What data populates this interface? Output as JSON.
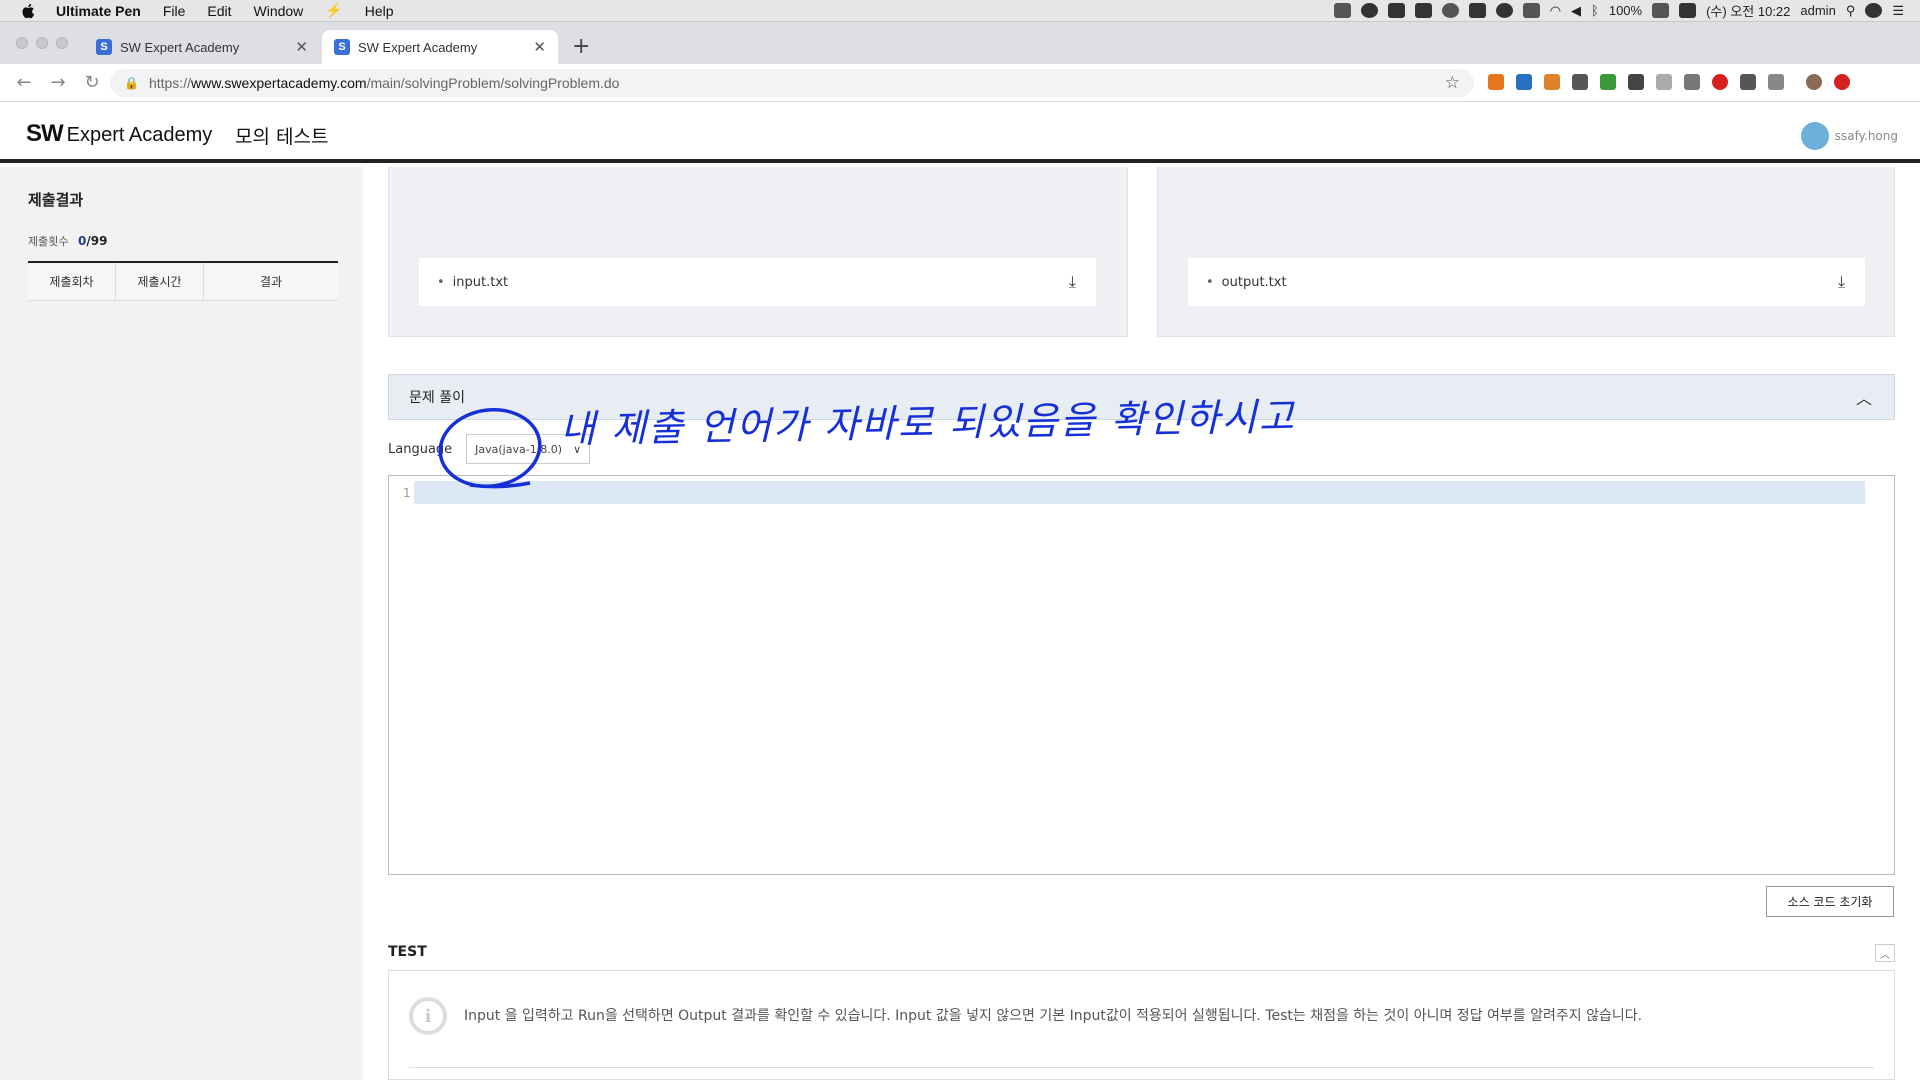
{
  "menubar": {
    "app_name": "Ultimate Pen",
    "items": [
      "File",
      "Edit",
      "Window",
      "Help"
    ],
    "battery": "100%",
    "clock": "(수) 오전 10:22",
    "user": "admin"
  },
  "browser": {
    "tabs": [
      {
        "title": "SW Expert Academy",
        "favicon": "S"
      },
      {
        "title": "SW Expert Academy",
        "favicon": "S"
      }
    ],
    "url_prefix": "https://",
    "url_host": "www.swexpertacademy.com",
    "url_path": "/main/solvingProblem/solvingProblem.do"
  },
  "header": {
    "logo_sw": "SW",
    "logo_text": "Expert Academy",
    "subtitle": "모의 테스트",
    "username": "ssafy.hong"
  },
  "sidebar": {
    "title": "제출결과",
    "count_label": "제출횟수",
    "count_value": "0",
    "count_sep": "/",
    "count_max": "99",
    "columns": [
      "제출회차",
      "제출시간",
      "결과"
    ]
  },
  "io": {
    "input_file": "input.txt",
    "output_file": "output.txt"
  },
  "solve": {
    "section_title": "문제 풀이",
    "language_label": "Language",
    "language_value": "Java(java-1.8.0)",
    "line_number": "1",
    "reset_label": "소스 코드 초기화"
  },
  "test": {
    "title": "TEST",
    "info": "Input 을 입력하고 Run을 선택하면 Output 결과를 확인할 수 있습니다. Input 값을 넣지 않으면 기본 Input값이 적용되어 실행됩니다. Test는 채점을 하는 것이 아니며 정답 여부를 알려주지 않습니다."
  },
  "annotation": {
    "text": "내 제출 언어가 자바로 되있음을 확인하시고",
    "color": "#1530d8"
  },
  "colors": {
    "accent_blue": "#1d3f8a",
    "section_bg": "#e8edf3",
    "editor_highlight": "#dde8f7"
  }
}
